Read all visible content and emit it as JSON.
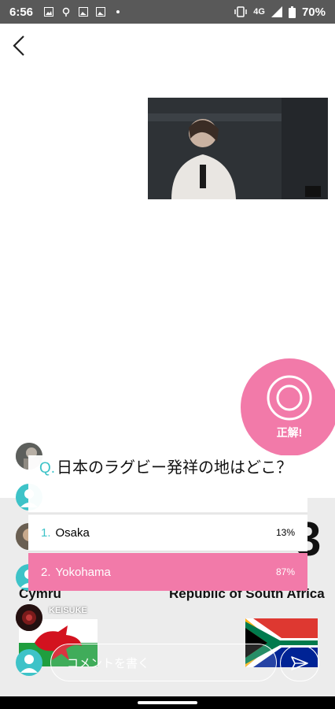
{
  "status": {
    "time": "6:56",
    "network": "4G",
    "battery": "70%"
  },
  "header": {
    "back_icon": "chevron-left-icon"
  },
  "correct_button": {
    "label": "正解!",
    "icon": "circle-icon"
  },
  "quiz": {
    "question_mark": "Q.",
    "question": "日本のラグビー発祥の地はどこ？",
    "options": [
      {
        "num": "1.",
        "label": "Osaka",
        "percent": "13%",
        "selected": false
      },
      {
        "num": "2.",
        "label": "Yokohama",
        "percent": "87%",
        "selected": true
      }
    ]
  },
  "board": {
    "team_left": "Cymru",
    "team_right": "Republic of South Africa",
    "right_glyph": "3"
  },
  "comment_user": "KEISUKE",
  "comment_input": {
    "placeholder": "コメントを書く"
  },
  "colors": {
    "accent_pink": "#f27aa9",
    "accent_teal": "#3ec3c8",
    "status_bar": "#595959"
  }
}
